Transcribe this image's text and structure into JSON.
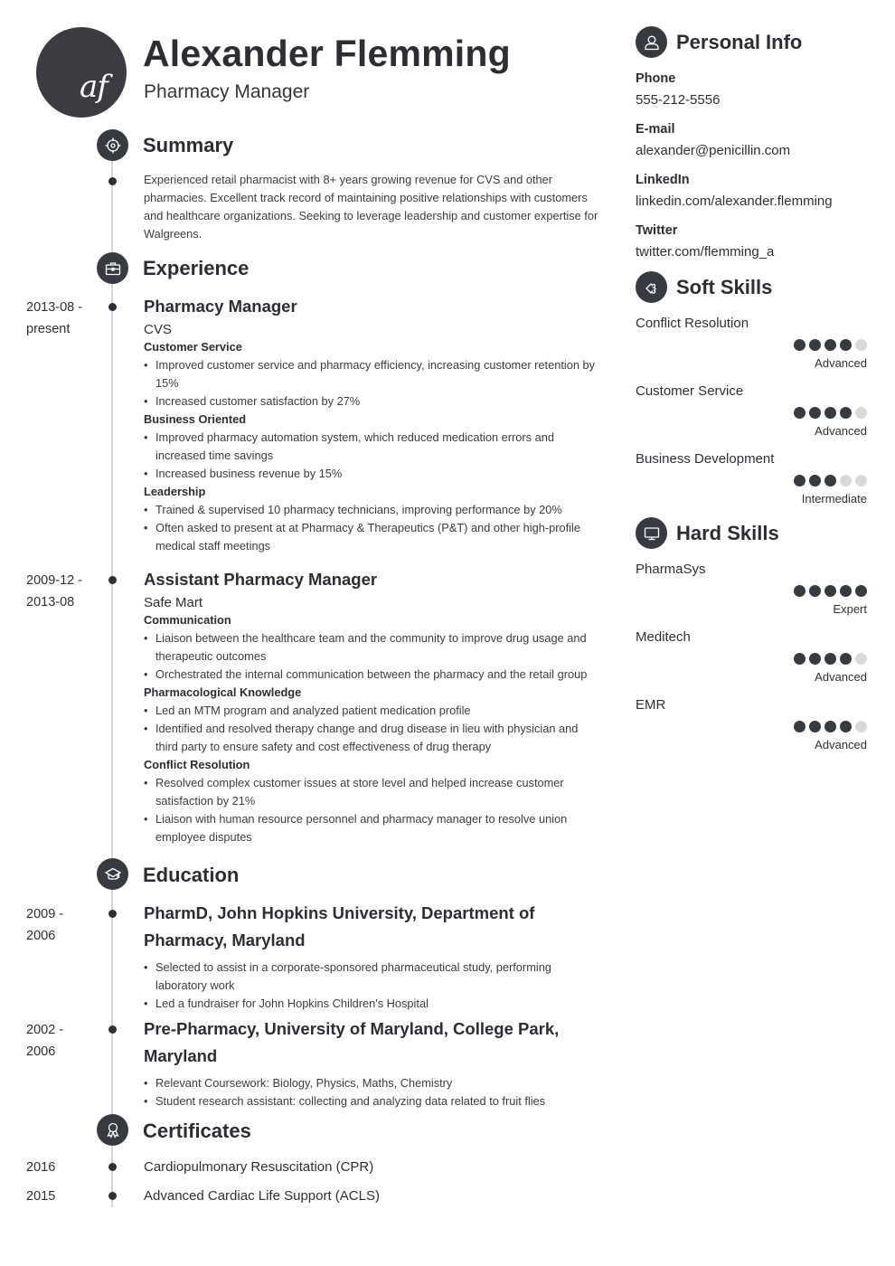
{
  "header": {
    "initials": "af",
    "name": "Alexander Flemming",
    "title": "Pharmacy Manager"
  },
  "summary": {
    "heading": "Summary",
    "icon": "target-icon",
    "text": "Experienced retail pharmacist with 8+ years growing revenue for CVS and other pharmacies. Excellent track record of maintaining positive relationships with customers and healthcare organizations. Seeking to leverage leadership and customer expertise for Walgreens."
  },
  "experience": {
    "heading": "Experience",
    "icon": "briefcase-icon",
    "jobs": [
      {
        "date_start": "2013-08 -",
        "date_end": "present",
        "title": "Pharmacy Manager",
        "company": "CVS",
        "groups": [
          {
            "category": "Customer Service",
            "bullets": [
              "Improved customer service and pharmacy efficiency, increasing customer retention by 15%",
              "Increased customer satisfaction by 27%"
            ]
          },
          {
            "category": "Business Oriented",
            "bullets": [
              "Improved pharmacy automation system, which reduced medication errors and increased time savings",
              "Increased business revenue by 15%"
            ]
          },
          {
            "category": "Leadership",
            "bullets": [
              "Trained & supervised 10 pharmacy technicians, improving performance by 20%",
              "Often asked to present at at Pharmacy & Therapeutics (P&T) and other high-profile medical staff meetings"
            ]
          }
        ]
      },
      {
        "date_start": "2009-12 -",
        "date_end": "2013-08",
        "title": "Assistant Pharmacy Manager",
        "company": "Safe Mart",
        "groups": [
          {
            "category": "Communication",
            "bullets": [
              "Liaison between the healthcare team and the community to improve drug usage and therapeutic outcomes",
              "Orchestrated the internal communication between the pharmacy and the retail group"
            ]
          },
          {
            "category": "Pharmacological Knowledge",
            "bullets": [
              "Led an MTM program and analyzed patient medication profile",
              "Identified and resolved therapy change and drug disease in lieu with physician and third party to ensure safety and cost effectiveness of drug therapy"
            ]
          },
          {
            "category": "Conflict Resolution",
            "bullets": [
              "Resolved complex customer issues at store level and helped increase customer satisfaction by 21%",
              "Liaison with human resource personnel and pharmacy manager to resolve union employee disputes"
            ]
          }
        ]
      }
    ]
  },
  "education": {
    "heading": "Education",
    "icon": "graduation-cap-icon",
    "items": [
      {
        "date_start": "2009 -",
        "date_end": "2006",
        "title": "PharmD, John Hopkins University, Department of Pharmacy, Maryland",
        "bullets": [
          "Selected to assist in a corporate-sponsored pharmaceutical study, performing laboratory work",
          "Led a fundraiser for John Hopkins Children's Hospital"
        ]
      },
      {
        "date_start": "2002 -",
        "date_end": "2006",
        "title": "Pre-Pharmacy, University of Maryland, College Park, Maryland",
        "bullets": [
          "Relevant Coursework: Biology, Physics, Maths, Chemistry",
          "Student research assistant: collecting and analyzing data related to fruit flies"
        ]
      }
    ]
  },
  "certificates": {
    "heading": "Certificates",
    "icon": "award-ribbon-icon",
    "items": [
      {
        "year": "2016",
        "name": "Cardiopulmonary Resuscitation (CPR)"
      },
      {
        "year": "2015",
        "name": "Advanced Cardiac Life Support (ACLS)"
      }
    ]
  },
  "personal_info": {
    "heading": "Personal Info",
    "icon": "user-icon",
    "fields": [
      {
        "label": "Phone",
        "value": "555-212-5556"
      },
      {
        "label": "E-mail",
        "value": "alexander@penicillin.com"
      },
      {
        "label": "LinkedIn",
        "value": "linkedin.com/alexander.flemming"
      },
      {
        "label": "Twitter",
        "value": "twitter.com/flemming_a"
      }
    ]
  },
  "soft_skills": {
    "heading": "Soft Skills",
    "icon": "puzzle-piece-icon",
    "items": [
      {
        "name": "Conflict Resolution",
        "rating": 4,
        "max": 5,
        "level": "Advanced"
      },
      {
        "name": "Customer Service",
        "rating": 4,
        "max": 5,
        "level": "Advanced"
      },
      {
        "name": "Business Development",
        "rating": 3,
        "max": 5,
        "level": "Intermediate"
      }
    ]
  },
  "hard_skills": {
    "heading": "Hard Skills",
    "icon": "monitor-icon",
    "items": [
      {
        "name": "PharmaSys",
        "rating": 5,
        "max": 5,
        "level": "Expert"
      },
      {
        "name": "Meditech",
        "rating": 4,
        "max": 5,
        "level": "Advanced"
      },
      {
        "name": "EMR",
        "rating": 4,
        "max": 5,
        "level": "Advanced"
      }
    ]
  },
  "colors": {
    "accent_dark": "#373a40",
    "dot_off": "#d9d9d9",
    "timeline": "#d6d6d6"
  }
}
